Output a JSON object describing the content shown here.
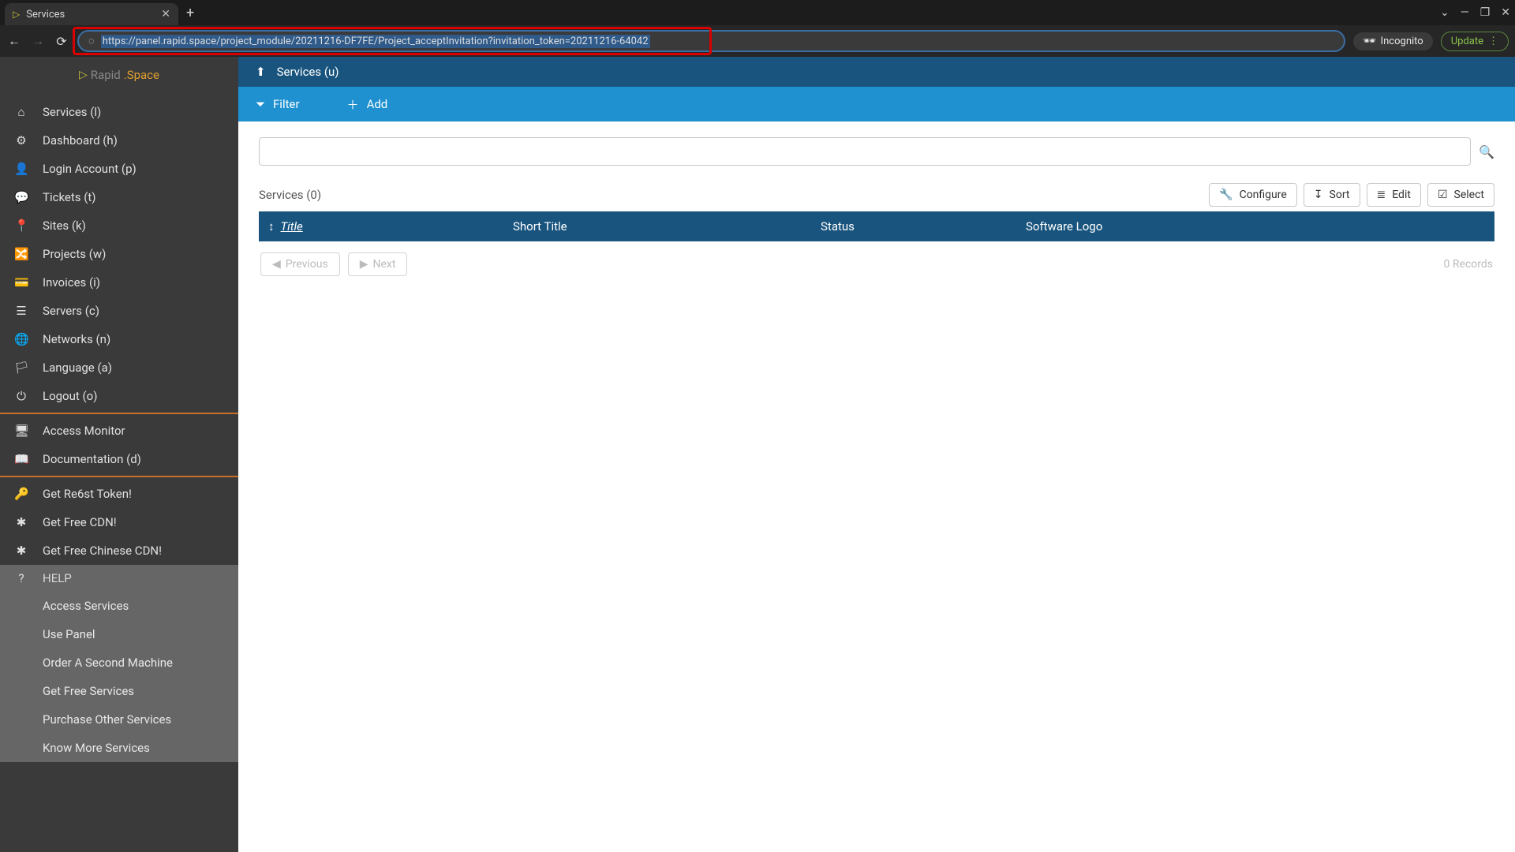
{
  "browser": {
    "tab_title": "Services",
    "url": "https://panel.rapid.space/project_module/20211216-DF7FE/Project_acceptInvitation?invitation_token=20211216-64042",
    "incognito_label": "Incognito",
    "update_label": "Update"
  },
  "logo": {
    "part1": "Rapid",
    "part2": ".Space"
  },
  "sidebar": {
    "group1": [
      {
        "icon": "home",
        "label": "Services (l)"
      },
      {
        "icon": "gears",
        "label": "Dashboard (h)"
      },
      {
        "icon": "user",
        "label": "Login Account (p)"
      },
      {
        "icon": "comments",
        "label": "Tickets (t)"
      },
      {
        "icon": "pin",
        "label": "Sites (k)"
      },
      {
        "icon": "share",
        "label": "Projects (w)"
      },
      {
        "icon": "card",
        "label": "Invoices (i)"
      },
      {
        "icon": "db",
        "label": "Servers (c)"
      },
      {
        "icon": "globe",
        "label": "Networks (n)"
      },
      {
        "icon": "lang",
        "label": "Language (a)"
      },
      {
        "icon": "power",
        "label": "Logout (o)"
      }
    ],
    "group2": [
      {
        "icon": "monitor",
        "label": "Access Monitor"
      },
      {
        "icon": "book",
        "label": "Documentation (d)"
      }
    ],
    "group3": [
      {
        "icon": "key",
        "label": "Get Re6st Token!"
      },
      {
        "icon": "star",
        "label": "Get Free CDN!"
      },
      {
        "icon": "star",
        "label": "Get Free Chinese CDN!"
      }
    ],
    "help_heading": "HELP",
    "help_items": [
      "Access Services",
      "Use Panel",
      "Order A Second Machine",
      "Get Free Services",
      "Purchase Other Services",
      "Know More Services"
    ]
  },
  "breadcrumb": {
    "label": "Services (u)"
  },
  "actions": {
    "filter": "Filter",
    "add": "Add"
  },
  "listing": {
    "title": "Services (0)",
    "configure": "Configure",
    "sort": "Sort",
    "edit": "Edit",
    "select": "Select",
    "cols": {
      "title": "Title",
      "short": "Short Title",
      "status": "Status",
      "logo": "Software Logo"
    },
    "prev": "Previous",
    "next": "Next",
    "records": "0 Records"
  }
}
